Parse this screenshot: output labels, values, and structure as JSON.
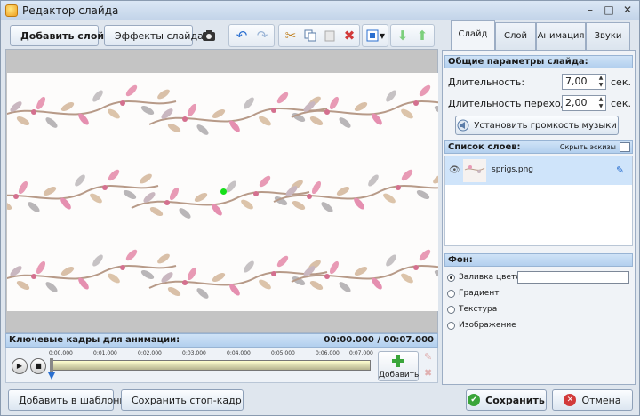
{
  "window": {
    "title": "Редактор слайда",
    "controls": {
      "minimize": "–",
      "maximize": "□",
      "close": "✕"
    }
  },
  "toolbar": {
    "add_layer": "Добавить слой",
    "slide_effects": "Эффекты слайда",
    "icons": [
      "camera-icon",
      "undo-icon",
      "redo-icon",
      "cut-icon",
      "copy-icon",
      "paste-icon",
      "delete-icon",
      "fit-icon",
      "dropdown-arrow-icon",
      "move-down-icon",
      "move-up-icon"
    ]
  },
  "keyframes": {
    "title": "Ключевые кадры для анимации:",
    "time": "00:00.000 / 00:07.000",
    "ruler": [
      "0:00.000",
      "0:01.000",
      "0:02.000",
      "0:03.000",
      "0:04.000",
      "0:05.000",
      "0:06.000",
      "0:07.000"
    ],
    "add_label": "Добавить"
  },
  "bottom": {
    "add_template": "Добавить в шаблоны",
    "save_frame": "Сохранить стоп-кадр",
    "save": "Сохранить",
    "cancel": "Отмена"
  },
  "tabs": [
    {
      "label": "Слайд",
      "active": true
    },
    {
      "label": "Слой",
      "active": false
    },
    {
      "label": "Анимация",
      "active": false
    },
    {
      "label": "Звуки",
      "active": false
    }
  ],
  "slide_params": {
    "header": "Общие параметры слайда:",
    "duration_label": "Длительность:",
    "duration_value": "7,00",
    "duration_unit": "сек.",
    "transition_label": "Длительность перехода:",
    "transition_value": "2,00",
    "transition_unit": "сек.",
    "music_button": "Установить громкость музыки"
  },
  "layers": {
    "header": "Список слоев:",
    "hide_thumbs": "Скрыть эскизы",
    "items": [
      {
        "name": "sprigs.png"
      }
    ]
  },
  "background": {
    "header": "Фон:",
    "options": [
      {
        "label": "Заливка цветом",
        "selected": true
      },
      {
        "label": "Градиент",
        "selected": false
      },
      {
        "label": "Текстура",
        "selected": false
      },
      {
        "label": "Изображение",
        "selected": false
      }
    ]
  },
  "colors": {
    "accent_green": "#3aa53a",
    "danger_red": "#d23a3a",
    "header_blue": "#b2cfee"
  }
}
